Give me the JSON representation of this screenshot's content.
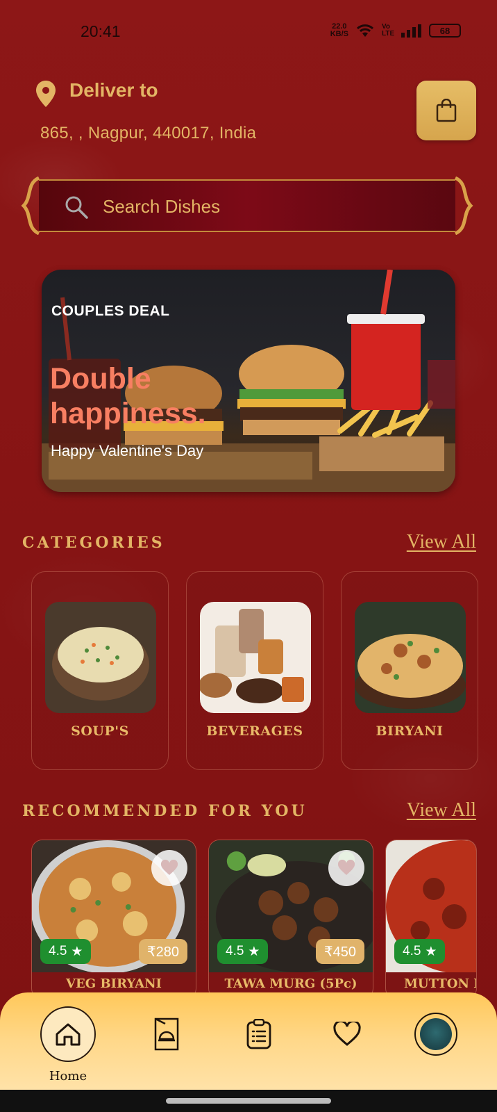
{
  "status_bar": {
    "time": "20:41",
    "net_speed_value": "22.0",
    "net_speed_unit": "KB/S",
    "network_label": "Vo LTE",
    "battery": "68"
  },
  "header": {
    "deliver_to": "Deliver to",
    "address": "865, , Nagpur, 440017, India"
  },
  "search": {
    "placeholder": "Search Dishes"
  },
  "banner": {
    "kicker": "COUPLES DEAL",
    "headline_line1": "Double",
    "headline_line2": "happiness.",
    "subtitle": "Happy Valentine's Day"
  },
  "categories": {
    "title": "CATEGORIES",
    "view_all": "View All",
    "items": [
      {
        "label": "SOUP'S"
      },
      {
        "label": "BEVERAGES"
      },
      {
        "label": "BIRYANI"
      }
    ]
  },
  "recommended": {
    "title": "RECOMMENDED FOR YOU",
    "view_all": "View All",
    "items": [
      {
        "name": "VEG BIRYANI",
        "rating": "4.5",
        "price": "₹280"
      },
      {
        "name": "TAWA MURG (5Pc)",
        "rating": "4.5",
        "price": "₹450"
      },
      {
        "name": "MUTTON M",
        "rating": "4.5",
        "price": ""
      }
    ]
  },
  "bottom_nav": {
    "home_label": "Home",
    "items": [
      "home-icon",
      "menu-card-icon",
      "orders-icon",
      "favorites-icon",
      "profile-avatar"
    ]
  },
  "colors": {
    "background": "#8a1616",
    "accent_gold": "#e3b565",
    "rating_green": "#1f8f2f",
    "nav_bar": "#ffd88a"
  }
}
